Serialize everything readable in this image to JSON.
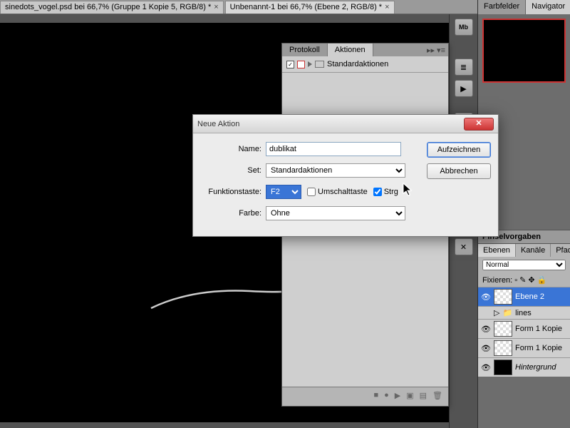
{
  "tabs": [
    {
      "label": "sinedots_vogel.psd bei 66,7% (Gruppe 1 Kopie 5, RGB/8) *"
    },
    {
      "label": "Unbenannt-1 bei 66,7% (Ebene 2, RGB/8) *"
    }
  ],
  "rightPanels": {
    "top": {
      "tab1": "Farbfelder",
      "tab2": "Navigator"
    },
    "brush": "Pinselvorgaben",
    "layers": {
      "tab1": "Ebenen",
      "tab2": "Kanäle",
      "tab3": "Pfade",
      "mode": "Normal",
      "lock": "Fixieren:"
    },
    "layerList": [
      {
        "name": "Ebene 2",
        "sel": true
      },
      {
        "name": "lines",
        "folder": true
      },
      {
        "name": "Form 1 Kopie"
      },
      {
        "name": "Form 1 Kopie"
      },
      {
        "name": "Hintergrund",
        "italic": true
      }
    ]
  },
  "actionsPanel": {
    "tab1": "Protokoll",
    "tab2": "Aktionen",
    "set": "Standardaktionen"
  },
  "dialog": {
    "title": "Neue Aktion",
    "name_label": "Name:",
    "name_value": "dublikat",
    "set_label": "Set:",
    "set_value": "Standardaktionen",
    "fkey_label": "Funktionstaste:",
    "fkey_value": "F2",
    "shift": "Umschalttaste",
    "ctrl": "Strg",
    "color_label": "Farbe:",
    "color_value": "Ohne",
    "btn_record": "Aufzeichnen",
    "btn_cancel": "Abbrechen"
  },
  "midIcons": {
    "mb": "Mb"
  }
}
